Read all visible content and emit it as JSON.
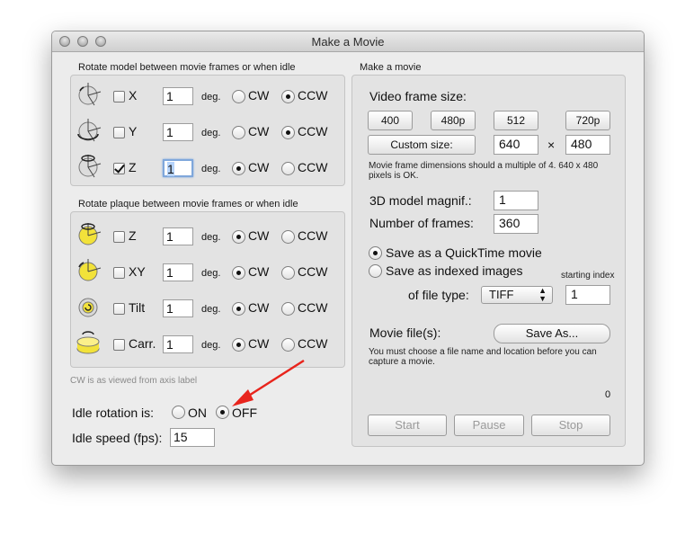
{
  "window": {
    "title": "Make a Movie"
  },
  "left": {
    "rotate_model_title": "Rotate model between movie frames or when idle",
    "rotate_plaque_title": "Rotate plaque between movie frames or when idle",
    "deg_label": "deg.",
    "cw_label": "CW",
    "ccw_label": "CCW",
    "model_rows": [
      {
        "axis": "X",
        "checked": false,
        "value": "1",
        "dir": "CCW"
      },
      {
        "axis": "Y",
        "checked": false,
        "value": "1",
        "dir": "CCW"
      },
      {
        "axis": "Z",
        "checked": true,
        "value": "1",
        "dir": "CW"
      }
    ],
    "plaque_rows": [
      {
        "axis": "Z",
        "checked": false,
        "value": "1",
        "dir": "CW"
      },
      {
        "axis": "XY",
        "checked": false,
        "value": "1",
        "dir": "CW"
      },
      {
        "axis": "Tilt",
        "checked": false,
        "value": "1",
        "dir": "CW"
      },
      {
        "axis": "Carr.",
        "checked": false,
        "value": "1",
        "dir": "CW"
      }
    ],
    "cw_note": "CW is as viewed from axis label",
    "idle_rotation_label": "Idle rotation is:",
    "idle_on": "ON",
    "idle_off": "OFF",
    "idle_state": "OFF",
    "idle_speed_label": "Idle speed (fps):",
    "idle_speed_value": "15"
  },
  "right": {
    "title": "Make a movie",
    "video_frame_size_label": "Video frame size:",
    "size_buttons": [
      "400",
      "480p",
      "512",
      "720p"
    ],
    "custom_size_button": "Custom size:",
    "width_value": "640",
    "times": "×",
    "height_value": "480",
    "dim_note_line1": "Movie frame dimensions should a multiple of 4. 640 x 480",
    "dim_note_line2": "pixels is OK.",
    "magnif_label": "3D model magnif.:",
    "magnif_value": "1",
    "frames_label": "Number of frames:",
    "frames_value": "360",
    "save_qt_label": "Save as a QuickTime movie",
    "save_images_label": "Save as indexed images",
    "starting_index_label": "starting index",
    "file_type_label": "of file type:",
    "file_type_value": "TIFF",
    "starting_index_value": "1",
    "movie_files_label": "Movie file(s):",
    "save_as_button": "Save As...",
    "must_choose_line1": "You must choose a file name and location before you can",
    "must_choose_line2": "capture a movie.",
    "counter": "0",
    "start_button": "Start",
    "pause_button": "Pause",
    "stop_button": "Stop"
  },
  "colors": {
    "arrow": "#e8241c",
    "window_bg": "#ececec",
    "box_bg": "#e3e3e3",
    "icon_yellow": "#f2e23a"
  }
}
